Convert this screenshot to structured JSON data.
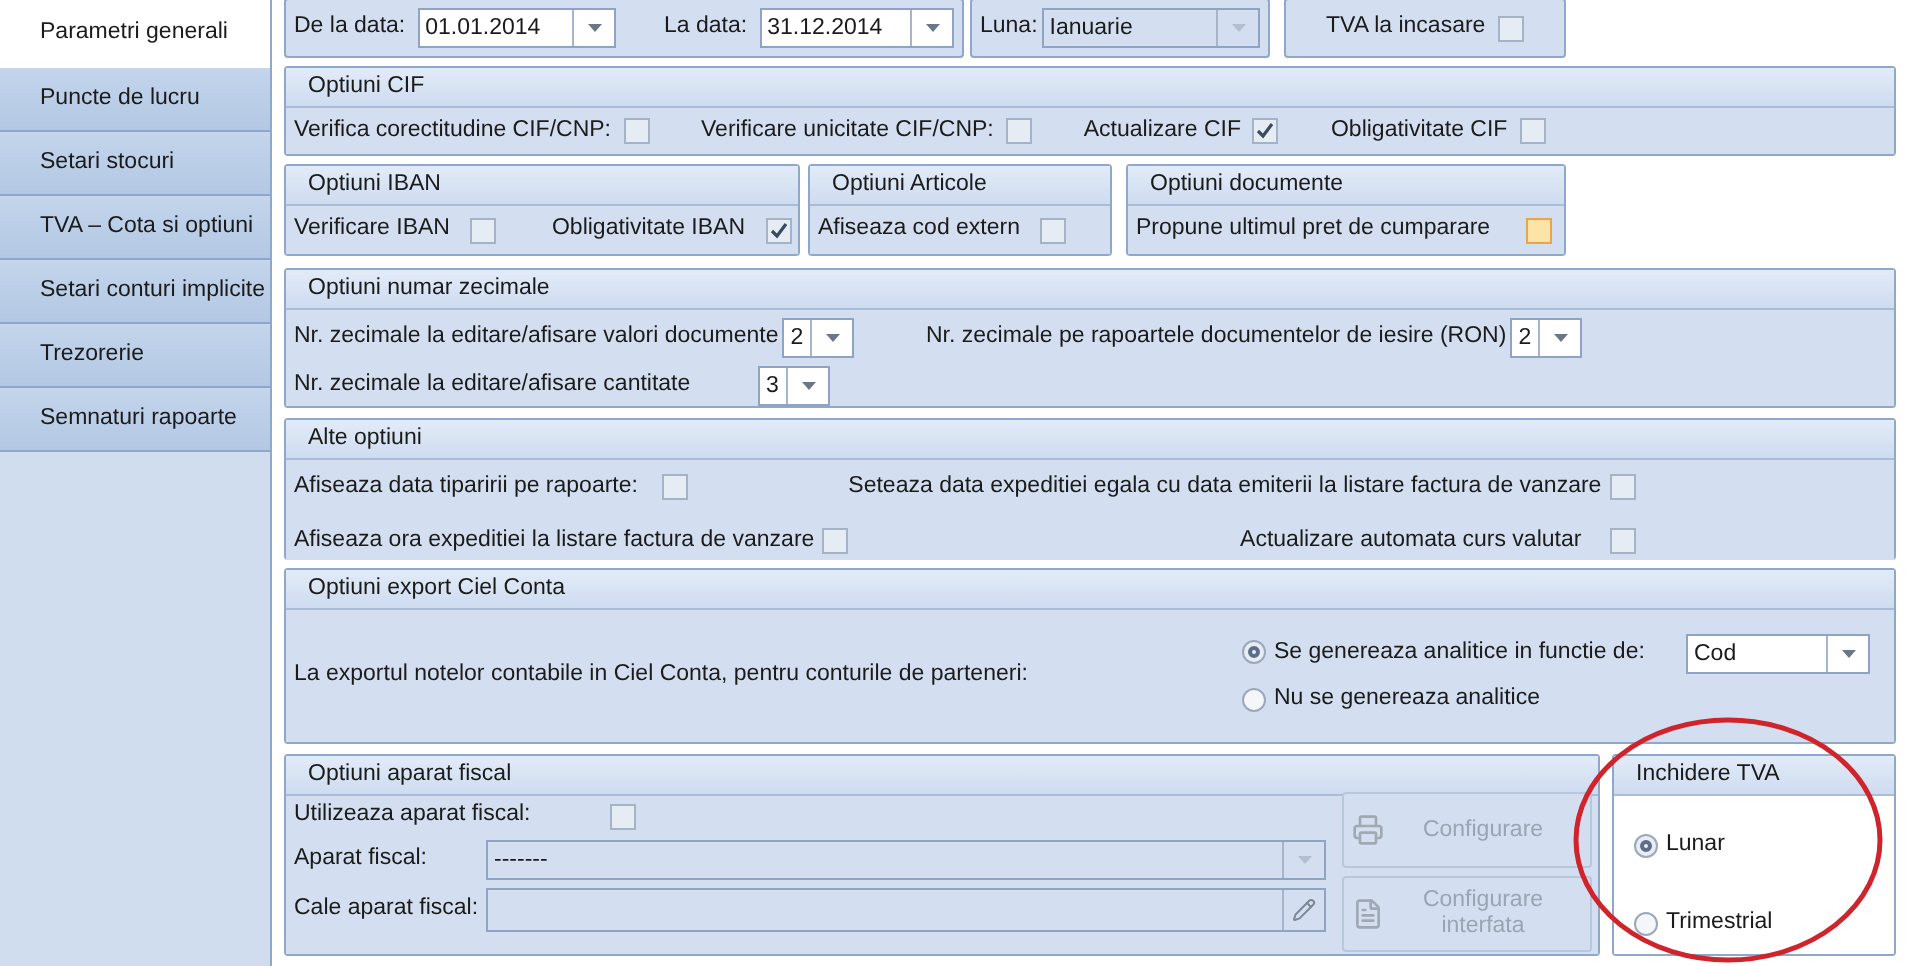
{
  "sidebar": {
    "items": [
      {
        "label": "Parametri generali",
        "selected": true
      },
      {
        "label": "Puncte de lucru",
        "selected": false
      },
      {
        "label": "Setari stocuri",
        "selected": false
      },
      {
        "label": "TVA – Cota si optiuni",
        "selected": false
      },
      {
        "label": "Setari conturi implicite",
        "selected": false
      },
      {
        "label": "Trezorerie",
        "selected": false
      },
      {
        "label": "Semnaturi rapoarte",
        "selected": false
      }
    ]
  },
  "period": {
    "from": {
      "label": "De la data:",
      "value": "01.01.2014"
    },
    "to": {
      "label": "La data:",
      "value": "31.12.2014"
    },
    "month": {
      "label": "Luna:",
      "value": "Ianuarie",
      "disabled": true
    },
    "tva_incasare": {
      "label": "TVA la incasare",
      "checked": false,
      "focused": false
    }
  },
  "cif": {
    "title": "Optiuni CIF",
    "options": [
      {
        "label": "Verifica corectitudine CIF/CNP:",
        "checked": false,
        "focused": false
      },
      {
        "label": "Verificare unicitate CIF/CNP:",
        "checked": false,
        "focused": false
      },
      {
        "label": "Actualizare CIF",
        "checked": true,
        "focused": false
      },
      {
        "label": "Obligativitate CIF",
        "checked": false,
        "focused": false
      }
    ]
  },
  "iban": {
    "title": "Optiuni IBAN",
    "options": [
      {
        "label": "Verificare IBAN",
        "checked": false,
        "focused": false
      },
      {
        "label": "Obligativitate IBAN",
        "checked": true,
        "focused": false
      }
    ]
  },
  "articole": {
    "title": "Optiuni Articole",
    "options": [
      {
        "label": "Afiseaza cod extern",
        "checked": false,
        "focused": false
      }
    ]
  },
  "documente": {
    "title": "Optiuni documente",
    "options": [
      {
        "label": "Propune ultimul pret de cumparare",
        "checked": false,
        "focused": true
      }
    ]
  },
  "zecimale": {
    "title": "Optiuni numar zecimale",
    "fields": [
      {
        "label": "Nr. zecimale la editare/afisare valori documente",
        "value": "2"
      },
      {
        "label": "Nr. zecimale pe rapoartele documentelor de iesire (RON)",
        "value": "2"
      },
      {
        "label": "Nr. zecimale la editare/afisare cantitate",
        "value": "3"
      }
    ]
  },
  "alte": {
    "title": "Alte optiuni",
    "options": [
      {
        "label": "Afiseaza data tiparirii pe rapoarte:",
        "checked": false,
        "focused": false
      },
      {
        "label": "Seteaza data expeditiei egala cu data emiterii la listare factura de vanzare",
        "checked": false,
        "focused": false
      },
      {
        "label": "Afiseaza ora expeditiei la listare factura de vanzare",
        "checked": false,
        "focused": false
      },
      {
        "label": "Actualizare automata curs valutar",
        "checked": false,
        "focused": false
      }
    ]
  },
  "export": {
    "title": "Optiuni export Ciel Conta",
    "text": "La exportul notelor contabile in Ciel Conta, pentru conturile de parteneri:",
    "choices": [
      {
        "label": "Se genereaza analitice in functie de:",
        "selected": true
      },
      {
        "label": "Nu se genereaza analitice",
        "selected": false
      }
    ],
    "criterion": "Cod"
  },
  "fiscal": {
    "title": "Optiuni aparat fiscal",
    "use": {
      "label": "Utilizeaza aparat fiscal:",
      "checked": false,
      "focused": false
    },
    "device": {
      "label": "Aparat fiscal:",
      "value": "-------",
      "disabled": true
    },
    "path": {
      "label": "Cale aparat fiscal:"
    },
    "buttons": [
      {
        "label": "Configurare",
        "disabled": true
      },
      {
        "label": "Configurare interfata",
        "disabled": true
      }
    ]
  },
  "inchidere": {
    "title": "Inchidere TVA",
    "choices": [
      {
        "label": "Lunar",
        "selected": true
      },
      {
        "label": "Trimestrial",
        "selected": false
      }
    ]
  }
}
